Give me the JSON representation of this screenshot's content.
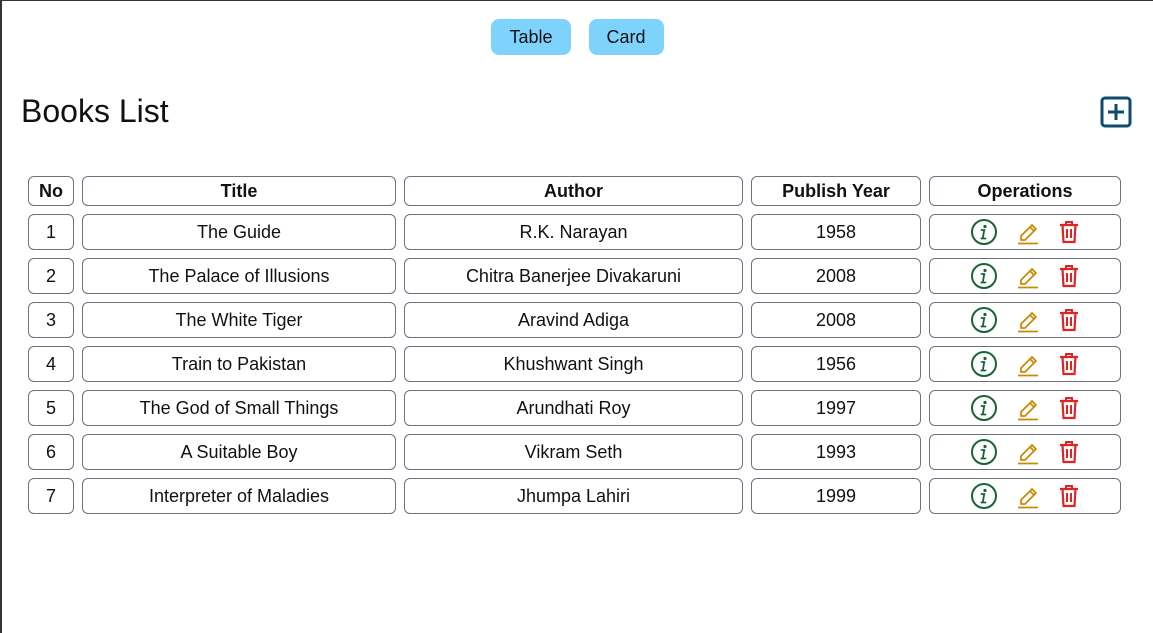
{
  "view_toggle": {
    "table_label": "Table",
    "card_label": "Card"
  },
  "header": {
    "title": "Books List"
  },
  "table": {
    "columns": [
      "No",
      "Title",
      "Author",
      "Publish Year",
      "Operations"
    ],
    "rows": [
      {
        "no": "1",
        "title": "The Guide",
        "author": "R.K. Narayan",
        "year": "1958"
      },
      {
        "no": "2",
        "title": "The Palace of Illusions",
        "author": "Chitra Banerjee Divakaruni",
        "year": "2008"
      },
      {
        "no": "3",
        "title": "The White Tiger",
        "author": "Aravind Adiga",
        "year": "2008"
      },
      {
        "no": "4",
        "title": "Train to Pakistan",
        "author": "Khushwant Singh",
        "year": "1956"
      },
      {
        "no": "5",
        "title": "The God of Small Things",
        "author": "Arundhati Roy",
        "year": "1997"
      },
      {
        "no": "6",
        "title": "A Suitable Boy",
        "author": "Vikram Seth",
        "year": "1993"
      },
      {
        "no": "7",
        "title": "Interpreter of Maladies",
        "author": "Jhumpa Lahiri",
        "year": "1999"
      }
    ]
  },
  "icons": {
    "add": "plus-square-icon",
    "info": "info-circle-icon",
    "edit": "pencil-icon",
    "delete": "trash-icon"
  },
  "colors": {
    "toggle_bg": "#7dd3fc",
    "add_icon": "#0c4a6e",
    "info_icon": "#166534",
    "edit_icon": "#ca8a04",
    "delete_icon": "#dc2626"
  }
}
